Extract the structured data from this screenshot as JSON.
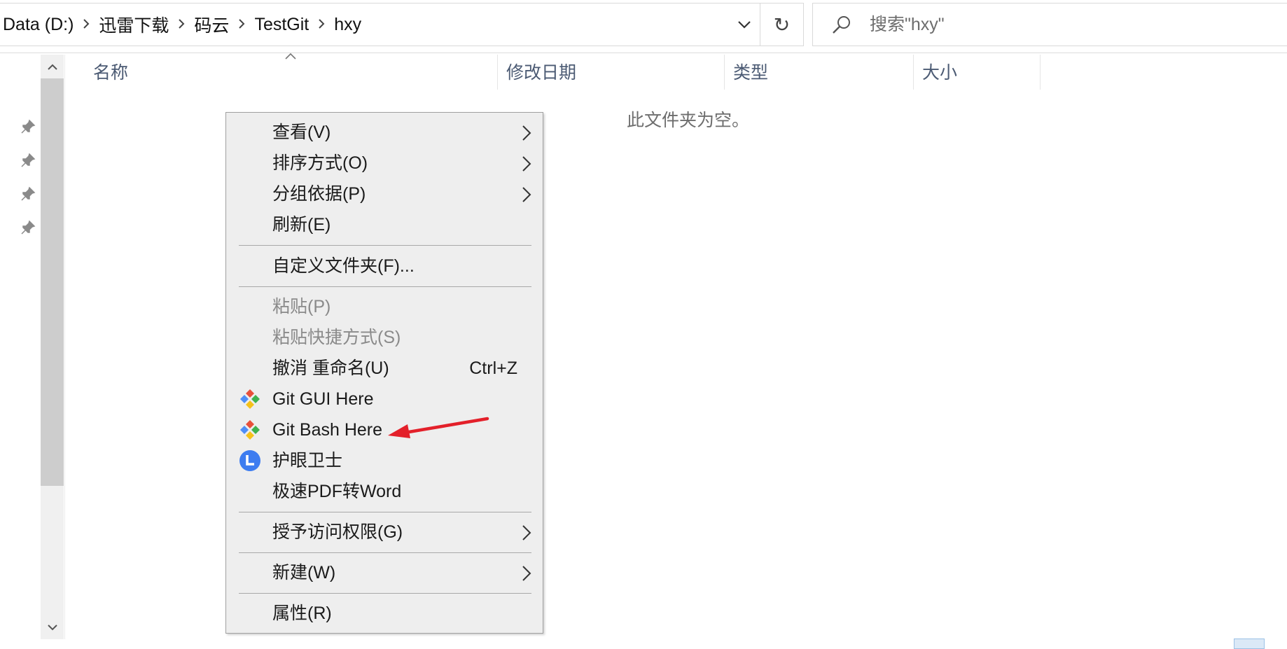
{
  "address": {
    "crumbs": [
      "Data (D:)",
      "迅雷下载",
      "码云",
      "TestGit",
      "hxy"
    ],
    "refresh_glyph": "↻"
  },
  "search": {
    "placeholder": "搜索\"hxy\""
  },
  "columns": [
    "名称",
    "修改日期",
    "类型",
    "大小"
  ],
  "empty_message": "此文件夹为空。",
  "context_menu": {
    "items": [
      {
        "label": "查看(V)",
        "submenu": true
      },
      {
        "label": "排序方式(O)",
        "submenu": true
      },
      {
        "label": "分组依据(P)",
        "submenu": true
      },
      {
        "label": "刷新(E)"
      },
      {
        "label": "自定义文件夹(F)..."
      },
      {
        "label": "粘贴(P)",
        "disabled": true
      },
      {
        "label": "粘贴快捷方式(S)",
        "disabled": true
      },
      {
        "label": "撤消 重命名(U)",
        "shortcut": "Ctrl+Z"
      },
      {
        "label": "Git GUI Here",
        "icon": "git-icon"
      },
      {
        "label": "Git Bash Here",
        "icon": "git-icon"
      },
      {
        "label": "护眼卫士",
        "icon": "eye-guard-icon"
      },
      {
        "label": "极速PDF转Word"
      },
      {
        "label": "授予访问权限(G)",
        "submenu": true
      },
      {
        "label": "新建(W)",
        "submenu": true
      },
      {
        "label": "属性(R)"
      }
    ]
  },
  "colors": {
    "menu_bg": "#eeeeee",
    "annotation_arrow": "#e3202a",
    "column_header_text": "#4b5a73"
  }
}
